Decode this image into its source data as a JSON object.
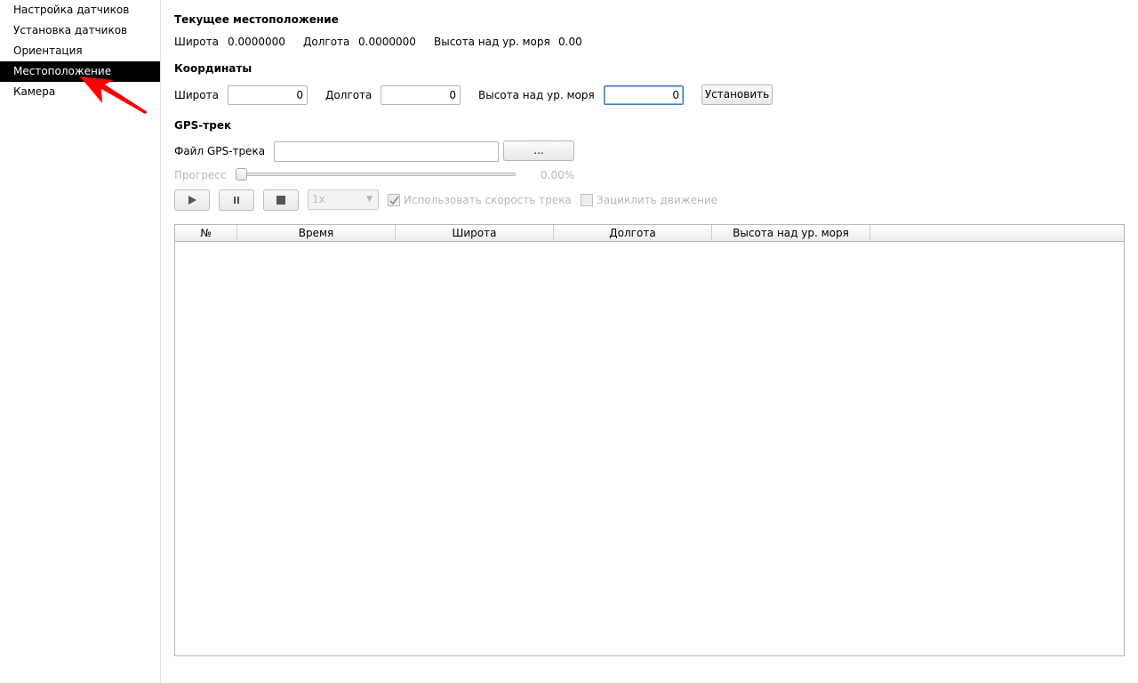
{
  "sidebar": {
    "items": [
      {
        "label": "Настройка датчиков",
        "active": false
      },
      {
        "label": "Установка датчиков",
        "active": false
      },
      {
        "label": "Ориентация",
        "active": false
      },
      {
        "label": "Местоположение",
        "active": true
      },
      {
        "label": "Камера",
        "active": false
      }
    ]
  },
  "current_location": {
    "title": "Текущее местоположение",
    "lat_label": "Широта",
    "lat_value": "0.0000000",
    "lon_label": "Долгота",
    "lon_value": "0.0000000",
    "alt_label": "Высота над ур. моря",
    "alt_value": "0.00"
  },
  "coordinates": {
    "title": "Координаты",
    "lat_label": "Широта",
    "lat_value": "0",
    "lon_label": "Долгота",
    "lon_value": "0",
    "alt_label": "Высота над ур. моря",
    "alt_value": "0",
    "set_button": "Установить"
  },
  "gps_track": {
    "title": "GPS-трек",
    "file_label": "Файл GPS-трека",
    "file_value": "",
    "browse_button": "...",
    "progress_label": "Прогресс",
    "progress_fraction": 0.0,
    "progress_text": "0.00%",
    "speed_value": "1x",
    "use_track_speed_label": "Использовать скорость трека",
    "use_track_speed_checked": true,
    "loop_label": "Зациклить движение",
    "loop_checked": false
  },
  "table": {
    "columns": [
      "№",
      "Время",
      "Широта",
      "Долгота",
      "Высота над ур. моря"
    ],
    "rows": []
  },
  "colors": {
    "active_bg": "#000000",
    "annotation_arrow": "#ff0000",
    "focus_border": "#3b7bbf"
  }
}
